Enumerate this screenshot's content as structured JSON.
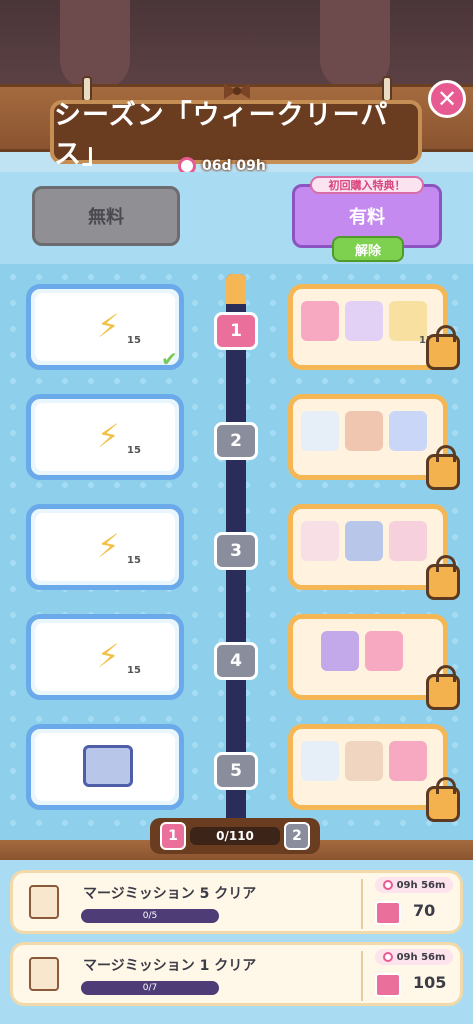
{
  "header": {
    "title": "シーズン「ウィークリーパス」",
    "timer": "06d 09h",
    "close_icon": "close-icon"
  },
  "tiers": {
    "free_label": "無料",
    "paid_label": "有料",
    "bonus_label": "初回購入特典！",
    "unlock_label": "解除"
  },
  "rewards": [
    {
      "level": "1",
      "free_qty": "15",
      "paid_qty": "150",
      "claimed": true
    },
    {
      "level": "2",
      "free_qty": "15"
    },
    {
      "level": "3",
      "free_qty": "15"
    },
    {
      "level": "4",
      "free_qty": "15"
    },
    {
      "level": "5",
      "free_qty": ""
    }
  ],
  "progress": {
    "text": "0/110",
    "current_level": "1",
    "next_level": "2"
  },
  "missions": [
    {
      "title": "マージミッション 5 クリア",
      "progress": "0/5",
      "time": "09h 56m",
      "points": "70"
    },
    {
      "title": "マージミッション 1 クリア",
      "progress": "0/7",
      "time": "09h 56m",
      "points": "105"
    }
  ],
  "colors": {
    "accent_pink": "#ea6f9a",
    "free_blue": "#6aa9ea",
    "paid_orange": "#f5b755",
    "unlock_green": "#7ed14e"
  }
}
